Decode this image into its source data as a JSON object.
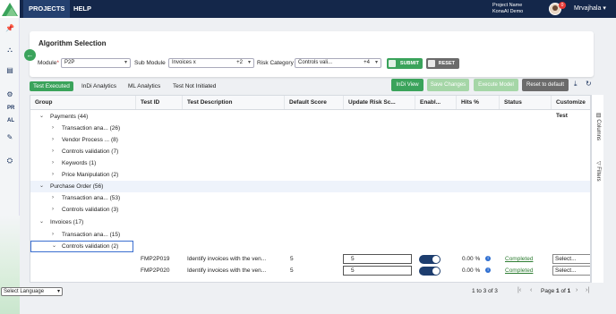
{
  "topbar": {
    "nav": [
      "PROJECTS",
      "HELP"
    ],
    "project_name_label": "Project Name",
    "project_name": "KonaAI Demo",
    "notification_count": "0",
    "user": "Mrvajhala"
  },
  "rail": {
    "text_items": [
      "PR",
      "AL"
    ]
  },
  "algorithm": {
    "title": "Algorithm Selection",
    "module_label": "Module",
    "module_required": "*",
    "module_value": "P2P",
    "submodule_label": "Sub Module",
    "submodule_value": "Invoices",
    "submodule_extra": "+2",
    "risk_label": "Risk Category",
    "risk_value": "Controls vali...",
    "risk_extra": "+4",
    "submit_label": "SUBMIT",
    "reset_label": "RESET"
  },
  "tabs": [
    "Test Executed",
    "InDi Analytics",
    "ML Analytics",
    "Test Not Initiated"
  ],
  "actions": {
    "indi_view": "InDi View",
    "save_changes": "Save Changes",
    "execute_model": "Execute Model",
    "reset_default": "Reset to default",
    "colors": {
      "green": "#3aa35b",
      "green_light": "#a5d6a7",
      "gray": "#6b6b6b"
    }
  },
  "grid": {
    "columns": [
      "Group",
      "Test ID",
      "Test Description",
      "Default Score",
      "Update Risk Sc...",
      "Enabl...",
      "Hits %",
      "Status",
      "Customize Test"
    ],
    "groups": [
      {
        "label": "Payments",
        "count": "(44)"
      },
      {
        "label": "Transaction ana...",
        "count": "(26)"
      },
      {
        "label": "Vendor Process ...",
        "count": "(8)"
      },
      {
        "label": "Controls validation",
        "count": "(7)"
      },
      {
        "label": "Keywords",
        "count": "(1)"
      },
      {
        "label": "Price Manipulation",
        "count": "(2)"
      },
      {
        "label": "Purchase Order",
        "count": "(56)"
      },
      {
        "label": "Transaction ana...",
        "count": "(53)"
      },
      {
        "label": "Controls validation",
        "count": "(3)"
      },
      {
        "label": "Invoices",
        "count": "(17)"
      },
      {
        "label": "Transaction ana...",
        "count": "(15)"
      },
      {
        "label": "Controls validation",
        "count": "(2)"
      }
    ],
    "rows": [
      {
        "test_id": "FMP2P019",
        "description": "Identify invoices with the ven...",
        "default_score": "5",
        "risk_score": "5",
        "hits": "0.00 %",
        "status": "Completed",
        "customize": "Select..."
      },
      {
        "test_id": "FMP2P020",
        "description": "Identify invoices with the ven...",
        "default_score": "5",
        "risk_score": "5",
        "hits": "0.00 %",
        "status": "Completed",
        "customize": "Select..."
      }
    ],
    "side_panels": [
      "Columns",
      "Filters"
    ]
  },
  "pager": {
    "range": "1 to 3 of 3",
    "page_label": "Page",
    "current": "1",
    "of_label": "of",
    "total": "1"
  },
  "language": {
    "label": "Select Language"
  }
}
